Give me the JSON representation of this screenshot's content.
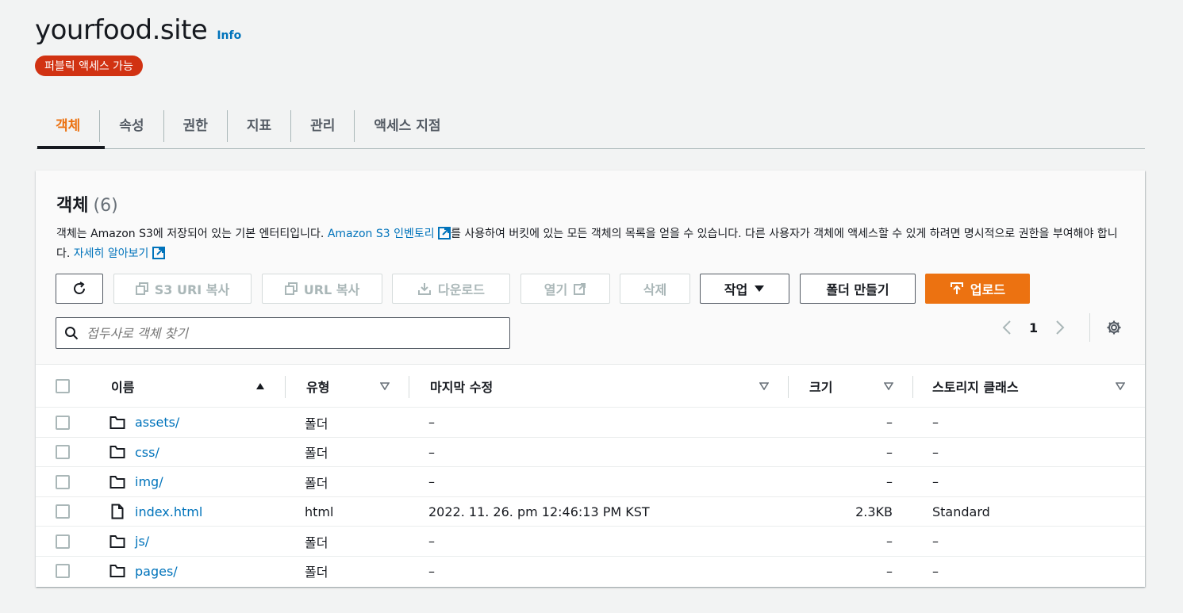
{
  "bucket": {
    "title": "yourfood.site",
    "info_label": "Info",
    "access_badge": "퍼블릭 액세스 가능"
  },
  "tabs": [
    {
      "label": "객체",
      "active": true
    },
    {
      "label": "속성"
    },
    {
      "label": "권한"
    },
    {
      "label": "지표"
    },
    {
      "label": "관리"
    },
    {
      "label": "액세스 지점"
    }
  ],
  "panel": {
    "title": "객체",
    "count": "(6)",
    "desc_part1": "객체는 Amazon S3에 저장되어 있는 기본 엔터티입니다. ",
    "desc_link1": "Amazon S3 인벤토리",
    "desc_part2": "를 사용하여 버킷에 있는 모든 객체의 목록을 얻을 수 있습니다. 다른 사용자가 객체에 액세스할 수 있게 하려면 명시적으로 권한을 부여해야 합니다. ",
    "desc_link2": "자세히 알아보기"
  },
  "toolbar": {
    "copy_s3_uri": "S3 URI 복사",
    "copy_url": "URL 복사",
    "download": "다운로드",
    "open": "열기",
    "delete": "삭제",
    "actions": "작업",
    "create_folder": "폴더 만들기",
    "upload": "업로드"
  },
  "search": {
    "placeholder": "접두사로 객체 찾기"
  },
  "pagination": {
    "page": "1"
  },
  "columns": {
    "name": "이름",
    "type": "유형",
    "modified": "마지막 수정",
    "size": "크기",
    "storage_class": "스토리지 클래스"
  },
  "rows": [
    {
      "name": "assets/",
      "kind": "folder",
      "type": "폴더",
      "modified": "–",
      "size": "–",
      "storage": "–"
    },
    {
      "name": "css/",
      "kind": "folder",
      "type": "폴더",
      "modified": "–",
      "size": "–",
      "storage": "–"
    },
    {
      "name": "img/",
      "kind": "folder",
      "type": "폴더",
      "modified": "–",
      "size": "–",
      "storage": "–"
    },
    {
      "name": "index.html",
      "kind": "file",
      "type": "html",
      "modified": "2022. 11. 26. pm 12:46:13 PM KST",
      "size": "2.3KB",
      "storage": "Standard"
    },
    {
      "name": "js/",
      "kind": "folder",
      "type": "폴더",
      "modified": "–",
      "size": "–",
      "storage": "–"
    },
    {
      "name": "pages/",
      "kind": "folder",
      "type": "폴더",
      "modified": "–",
      "size": "–",
      "storage": "–"
    }
  ],
  "colors": {
    "accent": "#ec7211",
    "link": "#0073bb",
    "badge": "#d13212"
  }
}
